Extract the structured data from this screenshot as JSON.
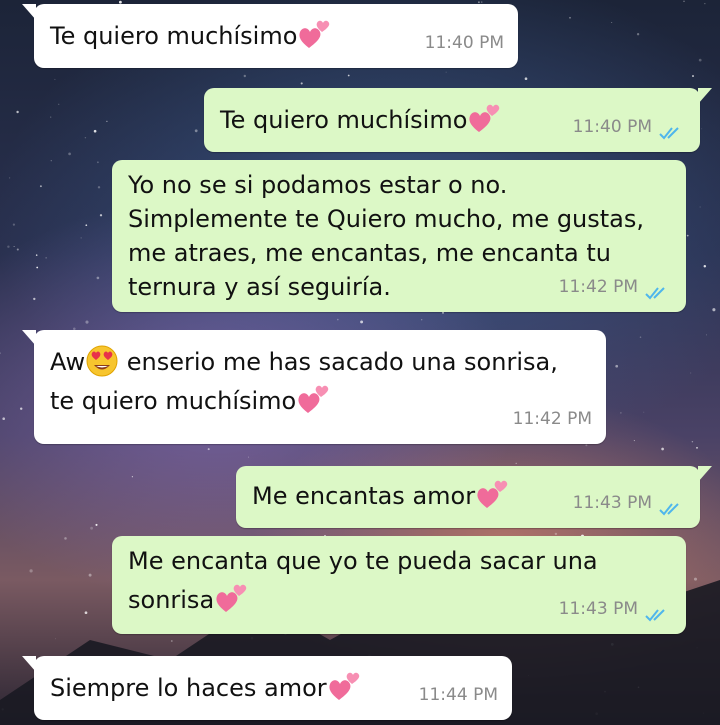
{
  "colors": {
    "incoming_bubble": "#ffffff",
    "outgoing_bubble": "#dcf8c6",
    "timestamp": "#8a8a8a",
    "read_ticks": "#4fb6ec",
    "heart": "#f06b9a"
  },
  "messages": [
    {
      "direction": "incoming",
      "lines": [
        "Te quiero muchísimo"
      ],
      "emoji": "two-hearts",
      "time": "11:40 PM"
    },
    {
      "direction": "outgoing",
      "lines": [
        "Te quiero muchísimo"
      ],
      "emoji": "two-hearts",
      "time": "11:40 PM",
      "status": "read"
    },
    {
      "direction": "outgoing",
      "lines": [
        "Yo no se si podamos estar o no.",
        "Simplemente te Quiero mucho, me gustas,",
        "me atraes, me encantas, me encanta tu",
        "ternura y así seguiría."
      ],
      "time": "11:42 PM",
      "status": "read"
    },
    {
      "direction": "incoming",
      "lines": [
        "Aw",
        "enserio me has sacado una sonrisa,",
        "te quiero muchísimo"
      ],
      "emoji": "heart-eyes, two-hearts",
      "time": "11:42 PM"
    },
    {
      "direction": "outgoing",
      "lines": [
        "Me encantas amor"
      ],
      "emoji": "two-hearts",
      "time": "11:43 PM",
      "status": "read"
    },
    {
      "direction": "outgoing",
      "lines": [
        "Me encanta que yo te pueda sacar una",
        "sonrisa"
      ],
      "emoji": "two-hearts",
      "time": "11:43 PM",
      "status": "read"
    },
    {
      "direction": "incoming",
      "lines": [
        "Siempre lo haces amor"
      ],
      "emoji": "two-hearts",
      "time": "11:44 PM"
    }
  ]
}
